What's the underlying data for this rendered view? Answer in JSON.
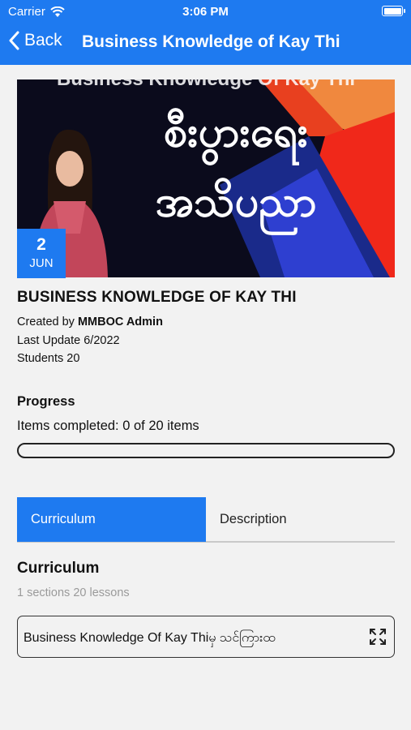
{
  "status_bar": {
    "carrier": "Carrier",
    "time": "3:06 PM"
  },
  "nav": {
    "back_label": "Back",
    "title": "Business Knowledge of  Kay Thi"
  },
  "banner": {
    "overline": "Business Knowledge Of Kay Thi",
    "line1": "စီးပွားရေး",
    "line2": "အသိပညာ",
    "date_day": "2",
    "date_month": "JUN"
  },
  "course": {
    "title": "BUSINESS KNOWLEDGE OF  KAY THI",
    "created_by_label": "Created by",
    "created_by": "MMBOC Admin",
    "last_update": "Last Update 6/2022",
    "students": "Students 20"
  },
  "progress": {
    "label": "Progress",
    "items_text": "Items completed: 0 of 20 items",
    "value": 0
  },
  "tabs": [
    {
      "label": "Curriculum",
      "active": true
    },
    {
      "label": "Description",
      "active": false
    }
  ],
  "curriculum": {
    "heading": "Curriculum",
    "summary": "1 sections 20 lessons",
    "sections": [
      {
        "title": "Business Knowledge Of Kay Thiမှ သင်ကြားထ"
      }
    ]
  },
  "colors": {
    "accent": "#1e7af0",
    "background": "#f2f2f2"
  }
}
